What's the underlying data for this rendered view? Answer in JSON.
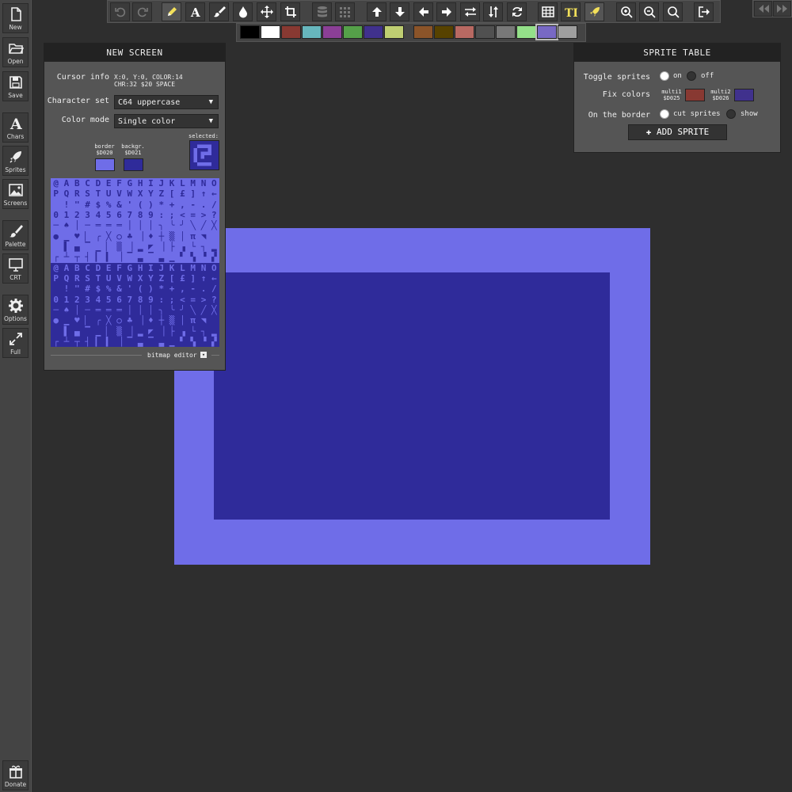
{
  "sidebar": {
    "items": [
      {
        "label": "New",
        "icon": "new-file-icon"
      },
      {
        "label": "Open",
        "icon": "folder-open-icon"
      },
      {
        "label": "Save",
        "icon": "save-icon"
      },
      {
        "label": "Chars",
        "icon": "letter-a-icon"
      },
      {
        "label": "Sprites",
        "icon": "rocket-icon"
      },
      {
        "label": "Screens",
        "icon": "image-icon"
      },
      {
        "label": "Palette",
        "icon": "brush-icon"
      },
      {
        "label": "CRT",
        "icon": "monitor-icon"
      },
      {
        "label": "Options",
        "icon": "gear-icon"
      },
      {
        "label": "Full",
        "icon": "expand-icon"
      },
      {
        "label": "Donate",
        "icon": "gift-icon"
      }
    ]
  },
  "palette": {
    "colors": [
      "#000000",
      "#ffffff",
      "#883932",
      "#67b6bd",
      "#8b3f96",
      "#55a049",
      "#40318d",
      "#bfce72",
      "#8b5429",
      "#574200",
      "#b86962",
      "#505050",
      "#787878",
      "#94e089",
      "#7869c4",
      "#9f9f9f"
    ],
    "selected_index": 14
  },
  "new_screen": {
    "title": "NEW SCREEN",
    "cursor_info_label": "Cursor info",
    "cursor_info_line1": "X:0, Y:0, COLOR:14",
    "cursor_info_line2": "CHR:32 $20 SPACE",
    "charset_label": "Character set",
    "charset_value": "C64 uppercase",
    "colormode_label": "Color mode",
    "colormode_value": "Single color",
    "border_label": "border",
    "border_addr": "$D020",
    "border_color": "#6f6de8",
    "backgr_label": "backgr.",
    "backgr_addr": "$D021",
    "backgr_color": "#2f2b9a",
    "selected_label": "selected:",
    "bitmap_editor_label": "bitmap editor",
    "char_rows": [
      "@ABCDEFGHIJKLMNO",
      "PQRSTUVWXYZ[£]↑←",
      " !\"#$%&'()*+,-./",
      "0123456789:;<=>?",
      "─♠│─═══│││╮╰╯╲╱╳",
      "●▁♥▏╭╳○♣▕♦┼▒│π◥ ",
      " ▌▄▔▁▏▒▕▂◤▕├▗└┐▂",
      "┌┴┬┤▎▍▕▔▃▔▃▁▘▚▝▞",
      "@ABCDEFGHIJKLMNO",
      "PQRSTUVWXYZ[£]↑←",
      " !\"#$%&'()*+,-./",
      "0123456789:;<=>?",
      "─♠│─═══│││╮╰╯╲╱╳",
      "●▁♥▏╭╳○♣▕♦┼▒│π◥ ",
      " ▌▄▔▁▏▒▕▂◤▕├▗└┐▂",
      "┌┴┬┤▎▍▕▔▃▔▃▁▘▚▝▞"
    ]
  },
  "sprite_table": {
    "title": "SPRITE TABLE",
    "toggle_label": "Toggle sprites",
    "toggle_on": "on",
    "toggle_off": "off",
    "fix_colors_label": "Fix colors",
    "multi1_label": "multi1",
    "multi1_addr": "$D025",
    "multi1_color": "#883932",
    "multi2_label": "multi2",
    "multi2_addr": "$D026",
    "multi2_color": "#40318d",
    "border_label": "On the border",
    "border_cut": "cut sprites",
    "border_show": "show",
    "add_sprite": "ADD SPRITE"
  },
  "canvas": {
    "border_color": "#6f6de8",
    "background_color": "#2f2b9a"
  }
}
